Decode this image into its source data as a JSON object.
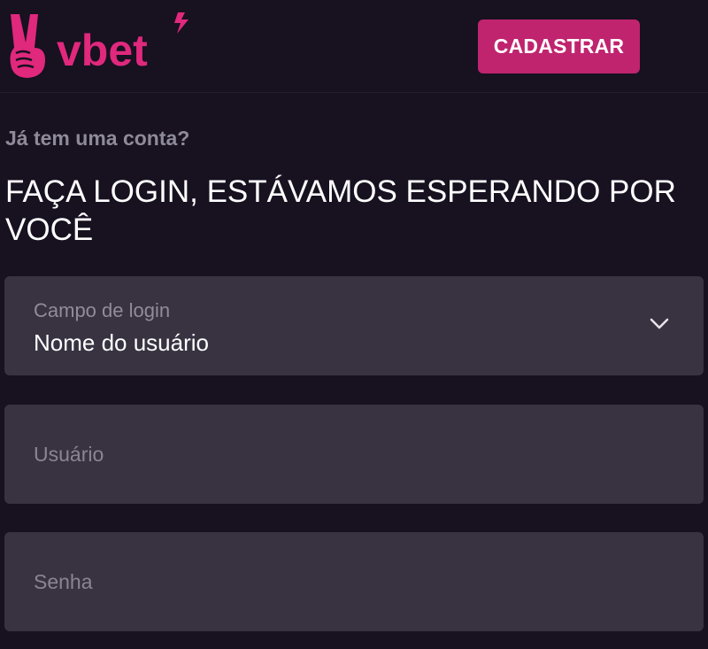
{
  "header": {
    "logo_text": "vbet",
    "register_label": "CADASTRAR"
  },
  "login": {
    "subtitle": "Já tem uma conta?",
    "title": "FAÇA LOGIN, ESTÁVAMOS ESPERANDO POR VOCÊ",
    "login_field": {
      "label": "Campo de login",
      "value": "Nome do usuário"
    },
    "username_placeholder": "Usuário",
    "password_placeholder": "Senha"
  },
  "colors": {
    "background": "#171120",
    "brand": "#e0287d",
    "button": "#c0246f",
    "field": "#383241"
  },
  "icons": {
    "logo_mark": "victory-hand-icon",
    "logo_spark": "lightning-icon",
    "dropdown": "chevron-down-icon"
  }
}
